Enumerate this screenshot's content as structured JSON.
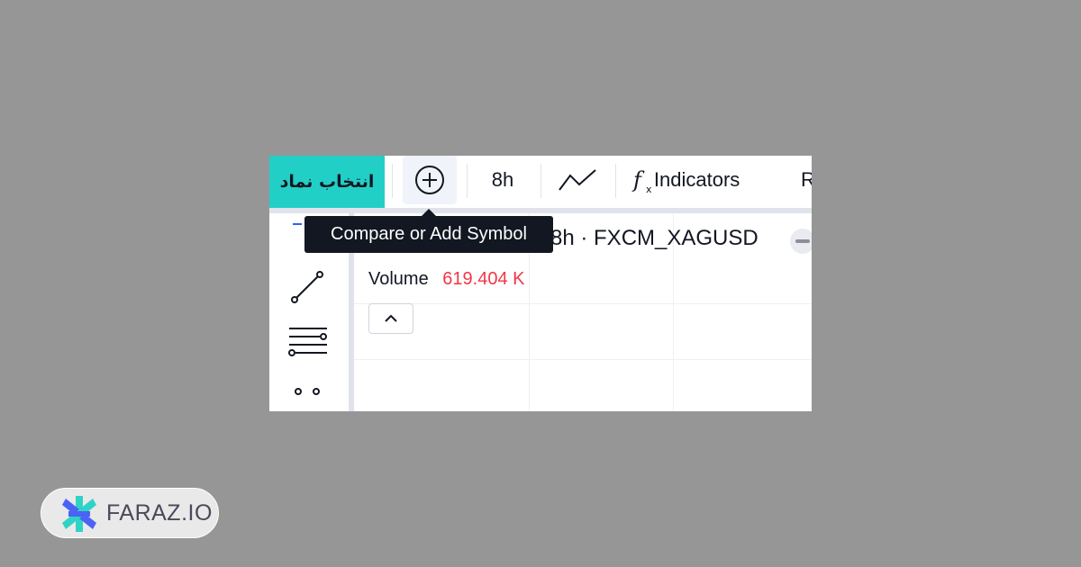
{
  "toolbar": {
    "symbol_button_label": "انتخاب نماد",
    "compare_icon": "plus-circle-icon",
    "interval_label": "8h",
    "chart_type_icon": "line-chart-icon",
    "indicators_icon": "fx-icon",
    "indicators_icon_glyph": "f",
    "indicators_icon_sub": "x",
    "indicators_label": "Indicators",
    "next_button_partial_label": "R"
  },
  "tooltip": {
    "text": "Compare or Add Symbol"
  },
  "left_toolbar": {
    "tools": [
      "crosshair-icon",
      "trend-line-icon",
      "fib-retracement-icon",
      "patterns-icon"
    ]
  },
  "chart": {
    "legend_title": "8h · FXCM_XAGUSD",
    "volume_label": "Volume",
    "volume_value": "619.404 K",
    "collapse_icon": "chevron-up-icon"
  },
  "brand": {
    "name": "FARAZ.IO",
    "logo_icon": "asterisk-logo-icon"
  },
  "colors": {
    "background": "#969696",
    "accent_teal": "#22cfc6",
    "volume_value": "#f23645",
    "tooltip_bg": "#131722",
    "logo_blue": "#4b63f5",
    "logo_teal": "#2fd3c5"
  }
}
